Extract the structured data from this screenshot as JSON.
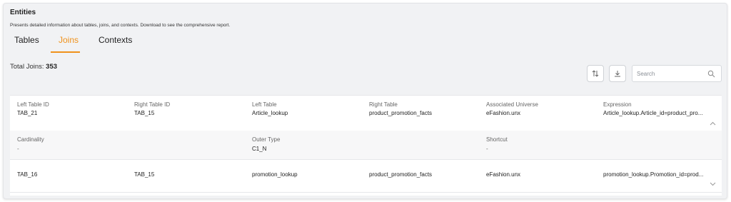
{
  "header": {
    "title": "Entities",
    "subtitle": "Presents detailed information about tables, joins, and contexts. Download to see the comprehensive report."
  },
  "tabs": [
    {
      "label": "Tables"
    },
    {
      "label": "Joins",
      "active": true
    },
    {
      "label": "Contexts"
    }
  ],
  "summary": {
    "total_label": "Total Joins: ",
    "total_value": "353"
  },
  "toolbar": {
    "sort_icon": "sort-icon",
    "download_icon": "download-icon"
  },
  "search": {
    "placeholder": "Search",
    "value": ""
  },
  "joins": [
    {
      "left_table_id_label": "Left Table ID",
      "left_table_id": "TAB_21",
      "right_table_id_label": "Right Table ID",
      "right_table_id": "TAB_15",
      "left_table_label": "Left Table",
      "left_table": "Article_lookup",
      "right_table_label": "Right Table",
      "right_table": "product_promotion_facts",
      "universe_label": "Associated Universe",
      "universe": "eFashion.unx",
      "expression_label": "Expression",
      "expression": "Article_lookup.Article_id=product_pro...",
      "cardinality_label": "Cardinality",
      "cardinality": "-",
      "outer_type_label": "Outer Type",
      "outer_type": "C1_N",
      "shortcut_label": "Shortcut",
      "shortcut": "-",
      "expanded": true
    },
    {
      "left_table_id": "TAB_16",
      "right_table_id": "TAB_15",
      "left_table": "promotion_lookup",
      "right_table": "product_promotion_facts",
      "universe": "eFashion.unx",
      "expression": "promotion_lookup.Promotion_id=prod...",
      "expanded": false
    }
  ],
  "colors": {
    "accent": "#f0921b",
    "panel_bg": "#f1f2f4",
    "expanded_bg": "#f7f7f8"
  }
}
